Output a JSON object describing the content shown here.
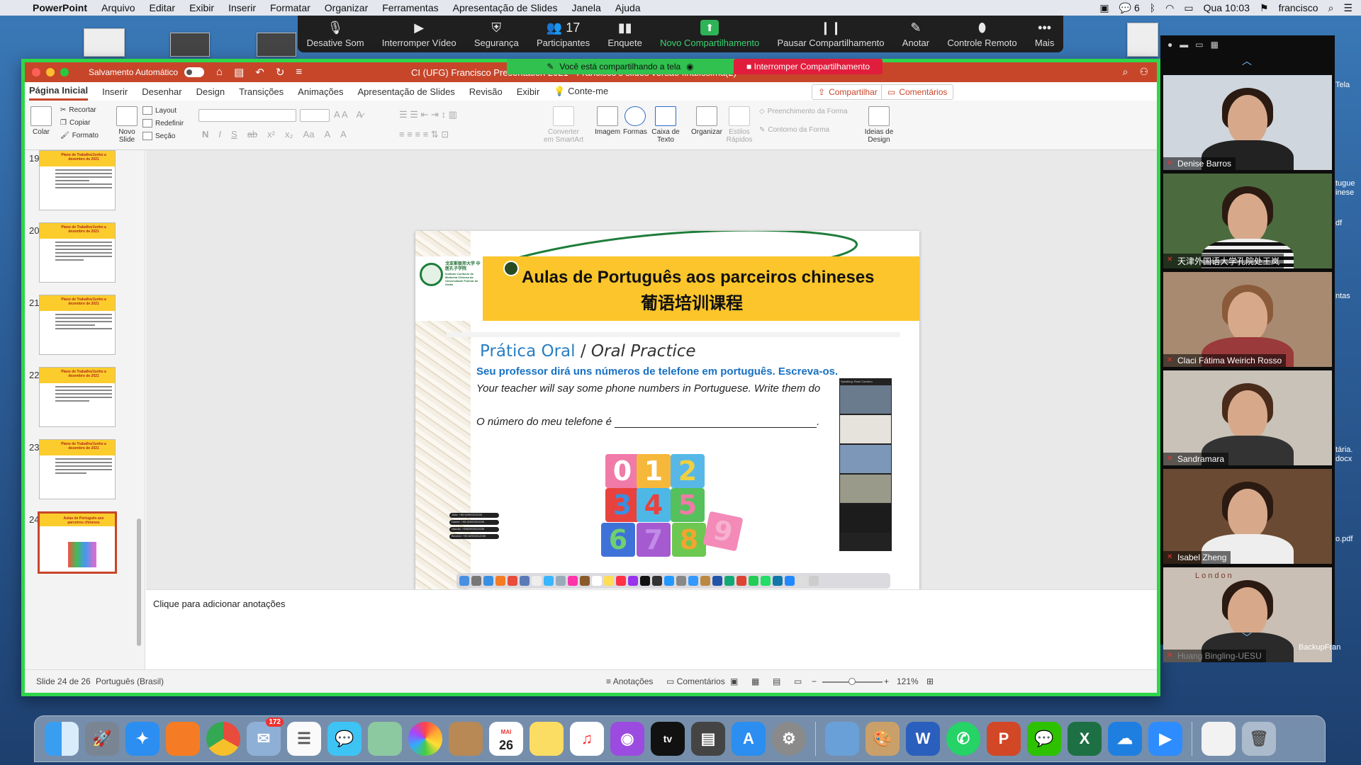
{
  "menubar": {
    "app": "PowerPoint",
    "items": [
      "Arquivo",
      "Editar",
      "Exibir",
      "Inserir",
      "Formatar",
      "Organizar",
      "Ferramentas",
      "Apresentação de Slides",
      "Janela",
      "Ajuda"
    ],
    "badge_count": "6",
    "clock": "Qua 10:03",
    "user": "francisco"
  },
  "zoom_toolbar": {
    "items": [
      {
        "label": "Desative Som",
        "icon": "mic-icon",
        "glyph": "🎙"
      },
      {
        "label": "Interromper Vídeo",
        "icon": "video-icon",
        "glyph": "▶"
      },
      {
        "label": "Segurança",
        "icon": "shield-icon",
        "glyph": "⛨"
      },
      {
        "label": "Participantes",
        "icon": "participants-icon",
        "glyph": "👥 17"
      },
      {
        "label": "Enquete",
        "icon": "poll-icon",
        "glyph": "▮▮"
      },
      {
        "label": "Novo Compartilhamento",
        "icon": "share-icon",
        "glyph": "⬆"
      },
      {
        "label": "Pausar Compartilhamento",
        "icon": "pause-icon",
        "glyph": "❙❙"
      },
      {
        "label": "Anotar",
        "icon": "pencil-icon",
        "glyph": "✎"
      },
      {
        "label": "Controle Remoto",
        "icon": "mouse-icon",
        "glyph": "⬮"
      },
      {
        "label": "Mais",
        "icon": "more-icon",
        "glyph": "•••"
      }
    ],
    "share_banner": "Você está compartilhando a tela",
    "stop_share": "Interromper Compartilhamento"
  },
  "window": {
    "autosave": "Salvamento Automático",
    "document_title": "CI (UFG) Francisco Presentation 2021 - Francisco's slides versão finalíssima(2)"
  },
  "tabs": [
    "Página Inicial",
    "Inserir",
    "Desenhar",
    "Design",
    "Transições",
    "Animações",
    "Apresentação de Slides",
    "Revisão",
    "Exibir",
    "Conte-me"
  ],
  "tab_buttons": {
    "share": "Compartilhar",
    "comments": "Comentários"
  },
  "ribbon": {
    "paste": "Colar",
    "cut": "Recortar",
    "copy": "Copiar",
    "format": "Formato",
    "new_slide": "Novo Slide",
    "layout": "Layout",
    "reset": "Redefinir",
    "section": "Seção",
    "smartart": "Converter em SmartArt",
    "image": "Imagem",
    "shapes": "Formas",
    "textbox": "Caixa de Texto",
    "arrange": "Organizar",
    "quick_styles": "Estilos Rápidos",
    "shape_fill": "Preenchimento da Forma",
    "shape_outline": "Contorno da Forma",
    "design_ideas": "Ideias de Design"
  },
  "thumbnails": [
    {
      "num": "19",
      "title": "Plano de Trabalho/Junho a dezembro de 2021"
    },
    {
      "num": "20",
      "title": "Plano de Trabalho/Junho a dezembro de 2021"
    },
    {
      "num": "21",
      "title": "Plano de Trabalho/Junho a dezembro de 2021"
    },
    {
      "num": "22",
      "title": "Plano de Trabalho/Junho a dezembro de 2021"
    },
    {
      "num": "23",
      "title": "Plano de Trabalho/Junho a dezembro de 2021"
    },
    {
      "num": "24",
      "title": "Aulas de Português aos parceiros chineses"
    }
  ],
  "slide": {
    "title": "Aulas de Português aos parceiros chineses",
    "title_cn": "葡语培训课程",
    "logo_cn": "戈亚斯联邦大学 中医孔子学院",
    "logo_pt": "Instituto Confúcio de Medicina Chinesa da Universidade Federal de Goiás",
    "heading_pt": "Prática Oral",
    "heading_sep": " / ",
    "heading_en": "Oral Practice",
    "line_pt": "Seu professor dirá uns números de telefone em português. Escreva-os.",
    "line_en": "Your teacher will say some phone numbers in Portuguese. Write them do",
    "line_fill": "O número do meu telefone é",
    "line_end": ".",
    "numbers": [
      "0",
      "1",
      "2",
      "3",
      "4",
      "5",
      "6",
      "7",
      "8",
      "9"
    ],
    "speaking": "Speaking: Rose Carneiro",
    "chat": [
      "Julio: +55 62993312035",
      "Daniel: +55 62993312035",
      "claudia: +5562993312035",
      "Beverid: +55 62993312035"
    ]
  },
  "notes_placeholder": "Clique para adicionar anotações",
  "status": {
    "slide": "Slide 24 de 26",
    "language": "Português (Brasil)",
    "notes": "Anotações",
    "comments": "Comentários",
    "zoom": "121%"
  },
  "gallery": [
    {
      "name": "Denise Barros"
    },
    {
      "name": "天津外国语大学孔院处王岚"
    },
    {
      "name": "Claci Fátima Weirich Rosso"
    },
    {
      "name": "Sandramara"
    },
    {
      "name": "Isabel Zheng"
    },
    {
      "name": "Huang Bingling-UESU"
    }
  ],
  "gallery_sign": "London",
  "desktop_right": [
    "Tela",
    "tugue",
    "inese",
    "df",
    "ntas",
    "tária.",
    "docx",
    "o.pdf",
    "BackupFran"
  ],
  "dock": {
    "calendar_month": "MAI",
    "calendar_day": "26",
    "mail_badge": "172",
    "apps": [
      "finder-icon",
      "launchpad-icon",
      "safari-icon",
      "firefox-icon",
      "chrome-icon",
      "mail-icon",
      "reminders-icon",
      "messages-icon",
      "maps-icon",
      "photos-icon",
      "contacts-icon",
      "calendar-icon",
      "notes-icon",
      "music-icon",
      "podcasts-icon",
      "appletv-icon",
      "printer-icon",
      "appstore-icon",
      "settings-icon",
      "preview-icon",
      "paint-icon",
      "word-icon",
      "whatsapp-icon",
      "powerpoint-icon",
      "wechat-icon",
      "excel-icon",
      "onedrive-icon",
      "zoom-icon",
      "document-icon",
      "trash-icon"
    ],
    "tv_label": "tv"
  }
}
